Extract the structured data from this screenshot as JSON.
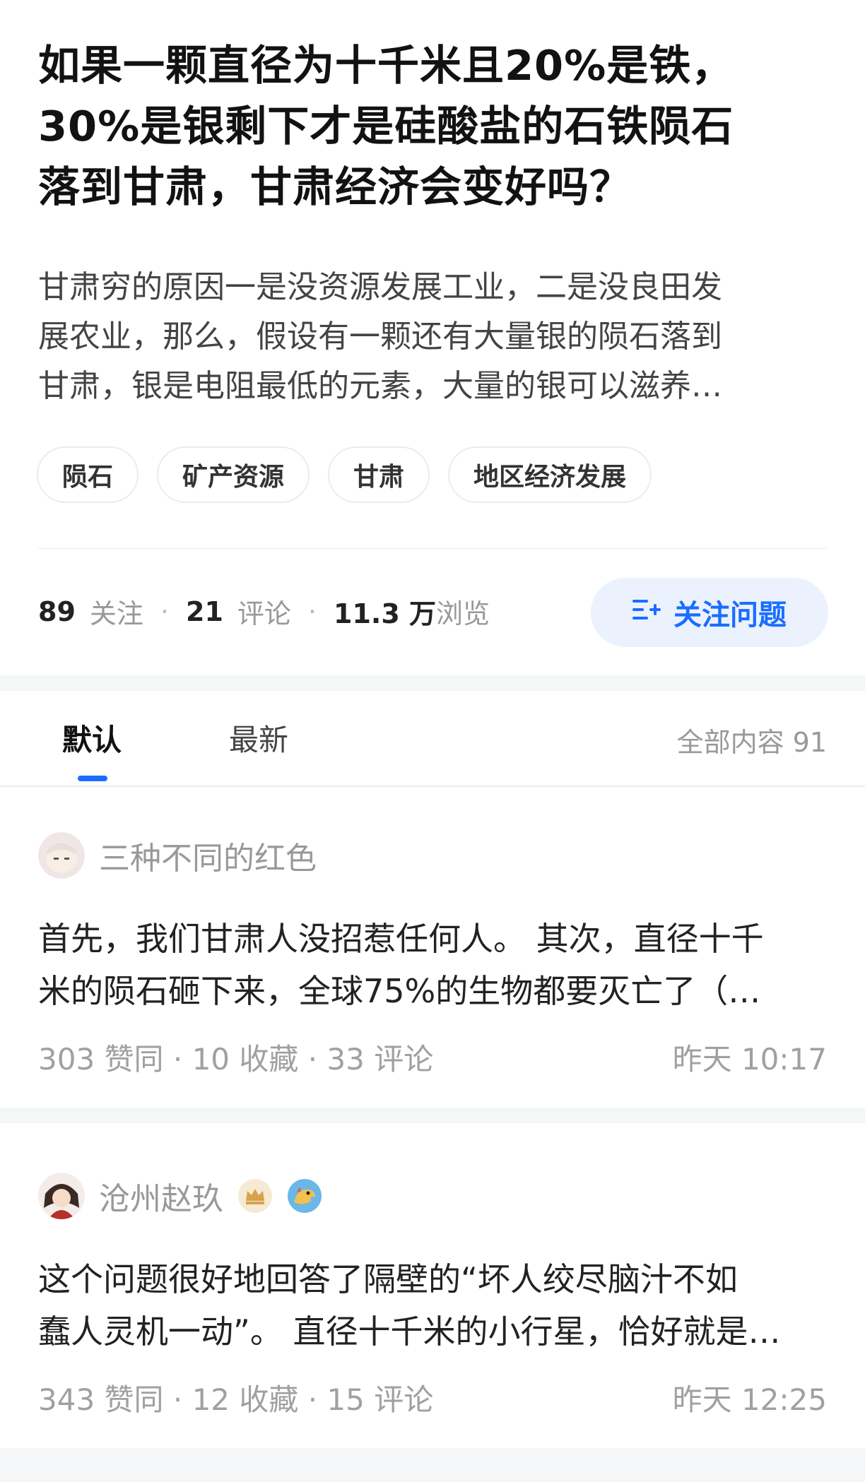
{
  "question": {
    "title_lines": [
      "如果一颗直径为十千米且20%是铁，",
      "30%是银剩下才是硅酸盐的石铁陨石",
      "落到甘肃，甘肃经济会变好吗？"
    ],
    "desc_lines": [
      "甘肃穷的原因一是没资源发展工业，二是没良田发",
      "展农业，那么，假设有一颗还有大量银的陨石落到",
      "甘肃，银是电阻最低的元素，大量的银可以滋养…"
    ],
    "tags": [
      "陨石",
      "矿产资源",
      "甘肃",
      "地区经济发展"
    ],
    "stats": {
      "followers": "89",
      "followers_label": "关注",
      "comments": "21",
      "comments_label": "评论",
      "views": "11.3 万",
      "views_label": "浏览"
    },
    "follow_button": "关注问题",
    "follow_icon": "follow-plus-icon"
  },
  "tabs": {
    "items": [
      "默认",
      "最新"
    ],
    "total": "全部内容 91"
  },
  "answers": [
    {
      "author": "三种不同的红色",
      "excerpt_lines": [
        "首先，我们甘肃人没招惹任何人。 其次，直径十千",
        "米的陨石砸下来，全球75%的生物都要灭亡了（…"
      ],
      "meta_left": "303 赞同 · 10 收藏 · 33 评论",
      "time": "昨天 10:17"
    },
    {
      "author": "沧州赵玖",
      "badges": [
        "crown-badge-icon",
        "dinosaur-badge-icon"
      ],
      "excerpt_lines": [
        "这个问题很好地回答了隔壁的“坏人绞尽脑汁不如",
        "蠢人灵机一动”。 直径十千米的小行星，恰好就是…"
      ],
      "meta_left": "343 赞同 · 12 收藏 · 15 评论",
      "time": "昨天 12:25"
    }
  ],
  "colors": {
    "accent": "#1a6dff",
    "band": "#f5f6f7"
  }
}
